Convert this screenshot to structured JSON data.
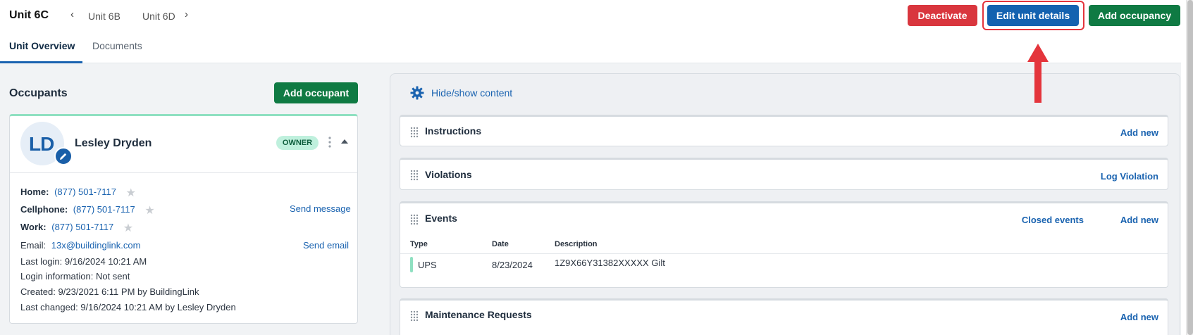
{
  "header": {
    "unit_title": "Unit 6C",
    "prev_unit": "Unit 6B",
    "next_unit": "Unit 6D",
    "deactivate_label": "Deactivate",
    "edit_label": "Edit unit details",
    "add_occupancy_label": "Add occupancy"
  },
  "tabs": [
    {
      "label": "Unit Overview",
      "active": true
    },
    {
      "label": "Documents",
      "active": false
    }
  ],
  "occupants": {
    "title": "Occupants",
    "add_label": "Add occupant",
    "card": {
      "initials": "LD",
      "name": "Lesley Dryden",
      "badge": "OWNER",
      "home_label": "Home:",
      "home_value": "(877) 501-7117",
      "cell_label": "Cellphone:",
      "cell_value": "(877) 501-7117",
      "work_label": "Work:",
      "work_value": "(877) 501-7117",
      "send_message": "Send message",
      "email_label": "Email:",
      "email_value": "13x@buildinglink.com",
      "send_email": "Send email",
      "last_login_label": "Last login:",
      "last_login_value": "9/16/2024 10:21 AM",
      "login_info_label": "Login information:",
      "login_info_value": "Not sent",
      "created_label": "Created:",
      "created_value": "9/23/2021 6:11 PM by BuildingLink",
      "last_changed_label": "Last changed:",
      "last_changed_value": "9/16/2024 10:21 AM by Lesley Dryden"
    }
  },
  "content": {
    "hide_show": "Hide/show content",
    "instructions": {
      "title": "Instructions",
      "add_new": "Add new"
    },
    "violations": {
      "title": "Violations",
      "log": "Log Violation"
    },
    "events": {
      "title": "Events",
      "closed": "Closed events",
      "add_new": "Add new",
      "columns": [
        "Type",
        "Date",
        "Description"
      ],
      "rows": [
        {
          "type": "UPS",
          "date": "8/23/2024",
          "description": "1Z9X66Y31382XXXXX Gilt"
        }
      ]
    },
    "maintenance": {
      "title": "Maintenance Requests",
      "add_new": "Add new"
    }
  },
  "colors": {
    "primary": "#1462b0",
    "danger": "#d9363e",
    "success": "#0f7a43",
    "annotation": "#e4353c"
  }
}
